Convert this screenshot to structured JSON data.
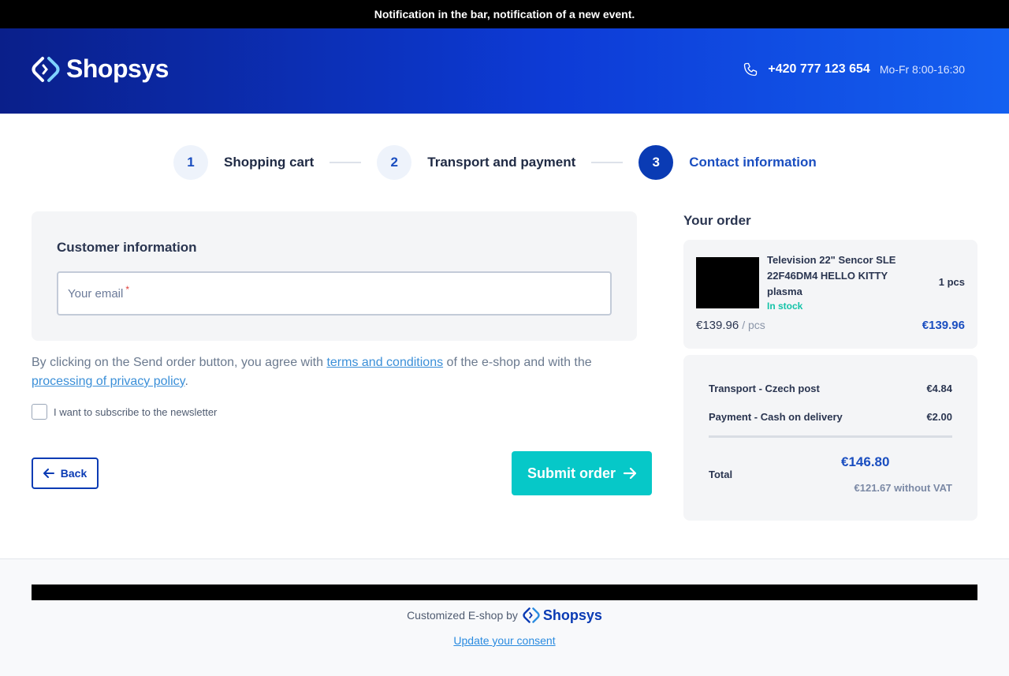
{
  "notification": "Notification in the bar, notification of a new event.",
  "header": {
    "logo_text": "Shopsys",
    "phone": "+420 777 123 654",
    "hours": "Mo-Fr 8:00-16:30",
    "gradient_colors": [
      "#0a1f8a",
      "#0d3bd6",
      "#1460f0"
    ]
  },
  "steps": [
    {
      "number": "1",
      "label": "Shopping cart",
      "active": false
    },
    {
      "number": "2",
      "label": "Transport and payment",
      "active": false
    },
    {
      "number": "3",
      "label": "Contact information",
      "active": true
    }
  ],
  "customer": {
    "title": "Customer information",
    "email_label": "Your email",
    "required_mark": "*"
  },
  "agreement": {
    "text_before": "By clicking on the Send order button, you agree with ",
    "terms_link": "terms and conditions",
    "text_middle": " of the e-shop and with the ",
    "privacy_link": "processing of privacy policy",
    "text_after": "."
  },
  "newsletter_label": "I want to subscribe to the newsletter",
  "buttons": {
    "back": "Back",
    "submit": "Submit order"
  },
  "order": {
    "title": "Your order",
    "item": {
      "name": "Television 22\" Sencor SLE 22F46DM4 HELLO KITTY plasma",
      "stock": "In stock",
      "quantity": "1 pcs",
      "unit_price": "€139.96",
      "unit": "/ pcs",
      "total": "€139.96"
    },
    "transport_label": "Transport - Czech post",
    "transport_price": "€4.84",
    "payment_label": "Payment - Cash on delivery",
    "payment_price": "€2.00",
    "total_label": "Total",
    "total_value": "€146.80",
    "total_without_vat": "€121.67 without VAT"
  },
  "footer": {
    "powered_by": "Customized E-shop by",
    "logo_text": "Shopsys",
    "consent_link": "Update your consent"
  },
  "colors": {
    "accent": "#0a3bb4",
    "submit": "#06c8c8",
    "stock": "#14c3a8",
    "link": "#3a8fd8"
  }
}
